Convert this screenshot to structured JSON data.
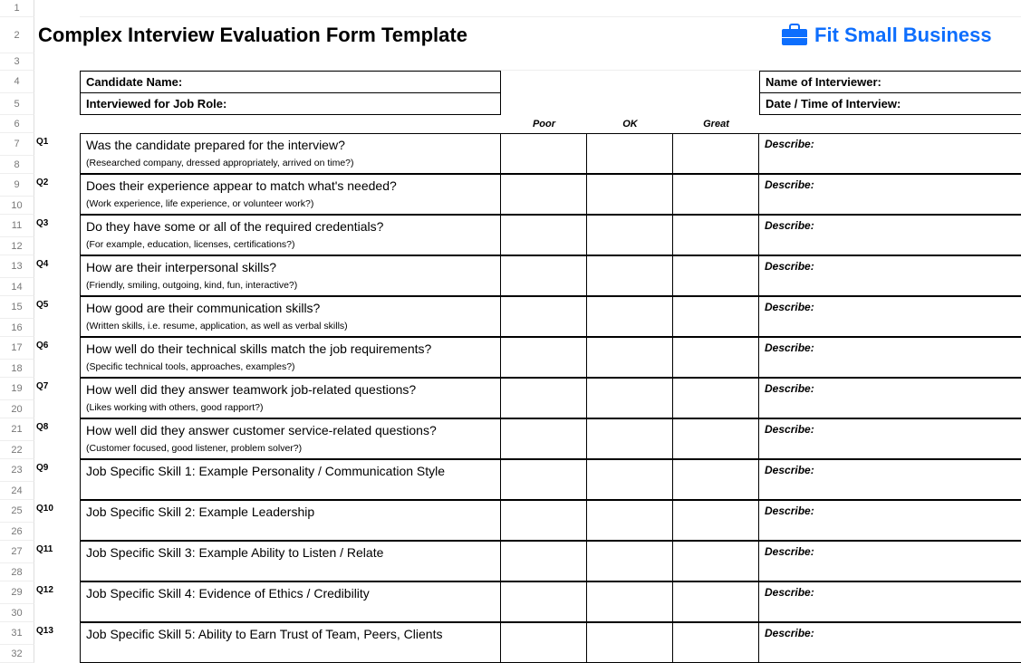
{
  "row_numbers": [
    "1",
    "2",
    "3",
    "4",
    "5",
    "6",
    "7",
    "8",
    "9",
    "10",
    "11",
    "12",
    "13",
    "14",
    "15",
    "16",
    "17",
    "18",
    "19",
    "20",
    "21",
    "22",
    "23",
    "24",
    "25",
    "26",
    "27",
    "28",
    "29",
    "30",
    "31",
    "32"
  ],
  "title": "Complex Interview Evaluation Form Template",
  "logo_text": "Fit Small Business",
  "fields": {
    "candidate_name": "Candidate Name:",
    "job_role": "Interviewed for Job Role:",
    "interviewer": "Name of Interviewer:",
    "datetime": "Date / Time of Interview:"
  },
  "ratings": {
    "poor": "Poor",
    "ok": "OK",
    "great": "Great"
  },
  "describe": "Describe:",
  "questions": [
    {
      "num": "Q1",
      "text": "Was the candidate prepared for the interview?",
      "hint": "(Researched company, dressed appropriately, arrived on time?)"
    },
    {
      "num": "Q2",
      "text": "Does their experience appear to match what's needed?",
      "hint": "(Work experience, life experience, or volunteer work?)"
    },
    {
      "num": "Q3",
      "text": "Do they have some or all of the required credentials?",
      "hint": "(For example, education, licenses, certifications?)"
    },
    {
      "num": "Q4",
      "text": "How are their interpersonal skills?",
      "hint": "(Friendly, smiling, outgoing, kind, fun, interactive?)"
    },
    {
      "num": "Q5",
      "text": "How good are their communication skills?",
      "hint": "(Written skills, i.e. resume, application, as well as verbal skills)"
    },
    {
      "num": "Q6",
      "text": "How well do their technical skills match the job requirements?",
      "hint": "(Specific technical tools, approaches, examples?)"
    },
    {
      "num": "Q7",
      "text": "How well did they answer teamwork job-related questions?",
      "hint": "(Likes working with others, good rapport?)"
    },
    {
      "num": "Q8",
      "text": "How well did they answer customer service-related questions?",
      "hint": "(Customer focused, good listener, problem solver?)"
    }
  ],
  "skills": [
    {
      "num": "Q9",
      "text": "Job Specific Skill 1: Example Personality / Communication Style"
    },
    {
      "num": "Q10",
      "text": "Job Specific Skill 2: Example Leadership"
    },
    {
      "num": "Q11",
      "text": "Job Specific Skill 3: Example Ability to Listen / Relate"
    },
    {
      "num": "Q12",
      "text": "Job Specific Skill 4: Evidence of Ethics / Credibility"
    },
    {
      "num": "Q13",
      "text": "Job Specific Skill 5: Ability to Earn Trust of Team, Peers, Clients"
    }
  ]
}
